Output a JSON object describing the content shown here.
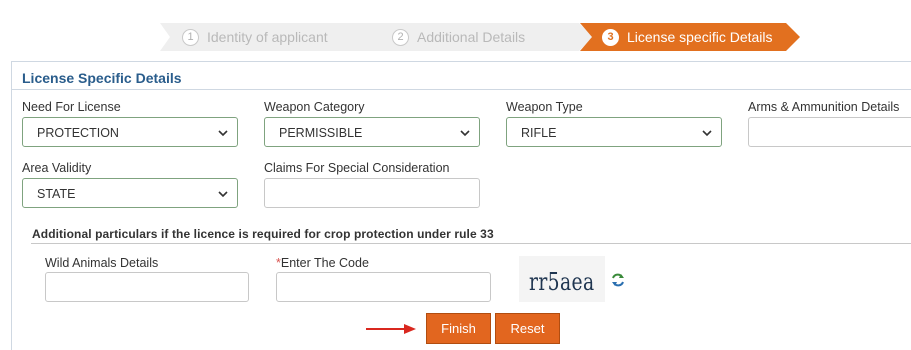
{
  "wizard": {
    "steps": [
      {
        "number": "1",
        "label": "Identity of applicant",
        "state": "inactive"
      },
      {
        "number": "2",
        "label": "Additional Details",
        "state": "inactive"
      },
      {
        "number": "3",
        "label": "License specific Details",
        "state": "active"
      }
    ]
  },
  "panel": {
    "title": "License Specific Details"
  },
  "fields": {
    "need_for_license": {
      "label": "Need For License",
      "value": "PROTECTION"
    },
    "weapon_category": {
      "label": "Weapon Category",
      "value": "PERMISSIBLE"
    },
    "weapon_type": {
      "label": "Weapon Type",
      "value": "RIFLE"
    },
    "arms_ammunition": {
      "label": "Arms & Ammunition Details",
      "value": ""
    },
    "area_validity": {
      "label": "Area Validity",
      "value": "STATE"
    },
    "claims_special": {
      "label": "Claims For Special Consideration",
      "value": ""
    }
  },
  "crop_section": {
    "title": "Additional particulars if the licence is required for crop protection under rule 33",
    "wild_animals": {
      "label": "Wild Animals Details",
      "value": ""
    },
    "code": {
      "required_mark": "*",
      "label": "Enter The Code",
      "value": ""
    },
    "captcha_text": "rr5aea"
  },
  "buttons": {
    "finish": "Finish",
    "reset": "Reset"
  },
  "colors": {
    "accent": "#e2661f",
    "title_blue": "#2a5d8c",
    "arrow_red": "#d9281f"
  },
  "icons": {
    "dropdown": "chevron-down-icon",
    "refresh": "refresh-icon",
    "pointer": "arrow-right-icon"
  }
}
